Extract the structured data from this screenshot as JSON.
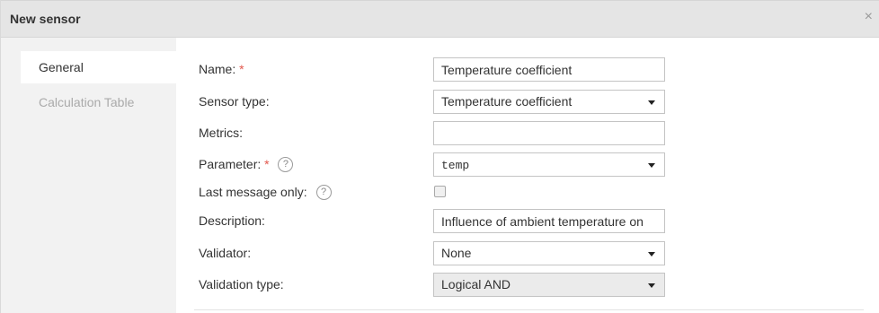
{
  "dialog": {
    "title": "New sensor",
    "close_glyph": "×"
  },
  "tabs": [
    {
      "label": "General",
      "active": true
    },
    {
      "label": "Calculation Table",
      "active": false
    }
  ],
  "form": {
    "name": {
      "label": "Name:",
      "required_mark": "*",
      "value": "Temperature coefficient"
    },
    "sensor_type": {
      "label": "Sensor type:",
      "value": "Temperature coefficient"
    },
    "metrics": {
      "label": "Metrics:",
      "value": ""
    },
    "parameter": {
      "label": "Parameter:",
      "required_mark": "*",
      "help": "?",
      "value": "temp"
    },
    "last_message_only": {
      "label": "Last message only:",
      "help": "?",
      "checked": false
    },
    "description": {
      "label": "Description:",
      "value": "Influence of ambient temperature on"
    },
    "validator": {
      "label": "Validator:",
      "value": "None"
    },
    "validation_type": {
      "label": "Validation type:",
      "value": "Logical AND"
    }
  },
  "icons": {
    "close": "close-icon",
    "help": "help-circle-icon",
    "dropdown": "chevron-down-icon"
  },
  "colors": {
    "required": "#e2574c",
    "titlebar": "#e5e5e5",
    "sidebar": "#f2f2f2",
    "inactive_tab": "#aaaaaa"
  }
}
